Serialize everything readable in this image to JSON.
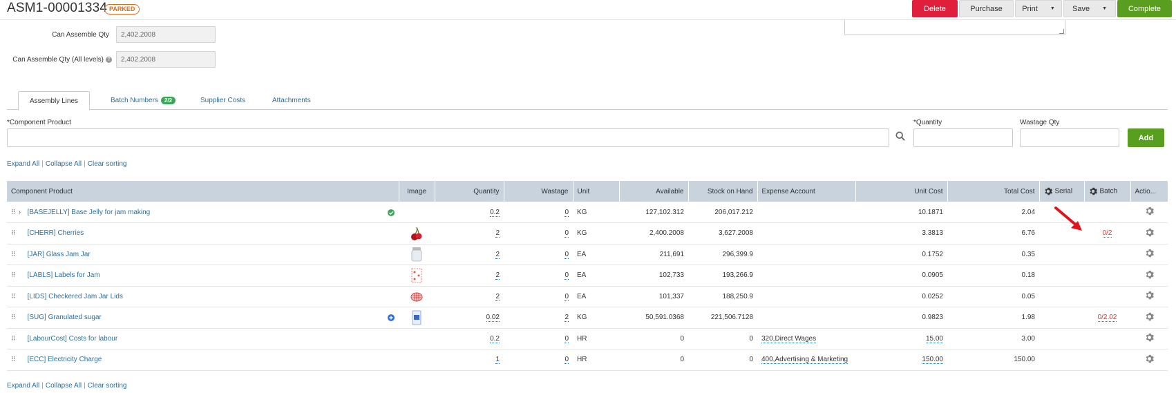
{
  "header": {
    "title": "ASM1-00001334",
    "status": "PARKED",
    "buttons": {
      "delete": "Delete",
      "purchase": "Purchase",
      "print": "Print",
      "save": "Save",
      "complete": "Complete"
    }
  },
  "form": {
    "can_assemble_label": "Can Assemble Qty",
    "can_assemble_value": "2,402.2008",
    "can_assemble_all_label": "Can Assemble Qty (All levels)",
    "can_assemble_all_value": "2,402.2008"
  },
  "tabs": [
    {
      "label": "Assembly Lines"
    },
    {
      "label": "Batch Numbers",
      "badge": "2/2"
    },
    {
      "label": "Supplier Costs"
    },
    {
      "label": "Attachments"
    }
  ],
  "add_row": {
    "component_label": "Component Product",
    "quantity_label": "Quantity",
    "wastage_label": "Wastage Qty",
    "add_button": "Add",
    "required_mark": "*"
  },
  "links": {
    "expand_all": "Expand All",
    "collapse_all": "Collapse All",
    "clear_sorting": "Clear sorting",
    "sep": "|"
  },
  "table": {
    "columns": [
      "Component Product",
      "Image",
      "Quantity",
      "Wastage",
      "Unit",
      "Available",
      "Stock on Hand",
      "Expense Account",
      "Unit Cost",
      "Total Cost",
      "Serial",
      "Batch",
      "Actio..."
    ],
    "rows": [
      {
        "product": "[BASEJELLY] Base Jelly for jam making",
        "quantity": "0.2",
        "wastage": "0",
        "unit": "KG",
        "available": "127,102.312",
        "stock": "206,017.212",
        "expense": "",
        "unit_cost": "10.1871",
        "total_cost": "2.04",
        "batch": "",
        "status": "ok"
      },
      {
        "product": "[CHERR] Cherries",
        "quantity": "2",
        "wastage": "0",
        "unit": "KG",
        "available": "2,400.2008",
        "stock": "3,627.2008",
        "expense": "",
        "unit_cost": "3.3813",
        "total_cost": "6.76",
        "batch": "0/2",
        "image": "cherry"
      },
      {
        "product": "[JAR] Glass Jam Jar",
        "quantity": "2",
        "wastage": "0",
        "unit": "EA",
        "available": "211,691",
        "stock": "296,399.9",
        "expense": "",
        "unit_cost": "0.1752",
        "total_cost": "0.35",
        "batch": "",
        "image": "jar"
      },
      {
        "product": "[LABLS] Labels for Jam",
        "quantity": "2",
        "wastage": "0",
        "unit": "EA",
        "available": "102,733",
        "stock": "193,266.9",
        "expense": "",
        "unit_cost": "0.0905",
        "total_cost": "0.18",
        "batch": "",
        "image": "labels"
      },
      {
        "product": "[LIDS] Checkered Jam Jar Lids",
        "quantity": "2",
        "wastage": "0",
        "unit": "EA",
        "available": "101,337",
        "stock": "188,250.9",
        "expense": "",
        "unit_cost": "0.0252",
        "total_cost": "0.05",
        "batch": "",
        "image": "lid"
      },
      {
        "product": "[SUG] Granulated sugar",
        "quantity": "0.02",
        "wastage": "2",
        "unit": "KG",
        "available": "50,591.0368",
        "stock": "221,506.7128",
        "expense": "",
        "unit_cost": "0.9823",
        "total_cost": "1.98",
        "batch": "0/2.02",
        "image": "sugar",
        "status": "info"
      },
      {
        "product": "[LabourCost] Costs for labour",
        "quantity": "0.2",
        "wastage": "0",
        "unit": "HR",
        "available": "0",
        "stock": "0",
        "expense": "320,Direct Wages",
        "unit_cost": "15.00",
        "total_cost": "3.00",
        "batch": ""
      },
      {
        "product": "[ECC] Electricity Charge",
        "quantity": "1",
        "wastage": "0",
        "unit": "HR",
        "available": "0",
        "stock": "0",
        "expense": "400,Advertising & Marketing",
        "unit_cost": "150.00",
        "total_cost": "150.00",
        "batch": ""
      }
    ]
  },
  "colors": {
    "delete": "#e01f3d",
    "complete": "#5a9e1f",
    "link": "#2a6f9b",
    "header_bg": "#c8d3dd",
    "parked": "#e06b1a",
    "annotation_arrow": "#e0141c"
  }
}
